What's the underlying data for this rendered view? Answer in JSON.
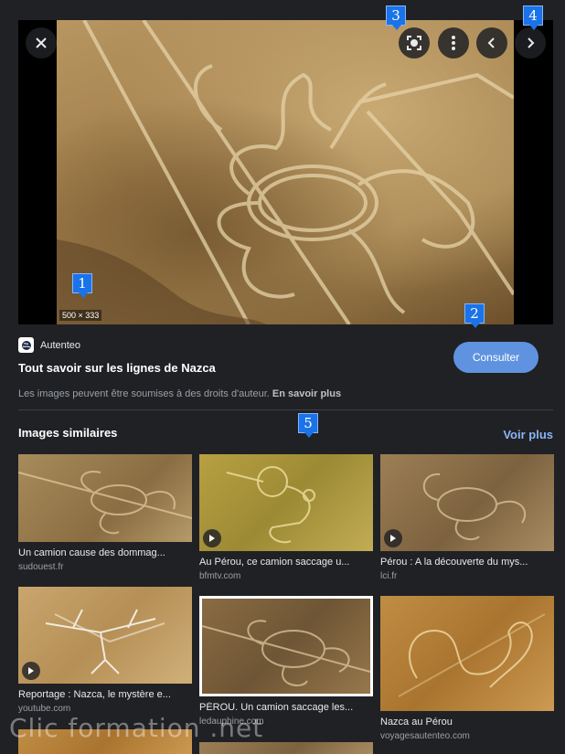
{
  "preview": {
    "dimensions": "500 × 333",
    "buttons": {
      "close_icon": "close-icon",
      "lens_icon": "lens-icon",
      "more_icon": "more-vert-icon",
      "prev_icon": "chevron-left-icon",
      "next_icon": "chevron-right-icon"
    }
  },
  "markers": [
    "1",
    "2",
    "3",
    "4",
    "5"
  ],
  "info": {
    "source_name": "Autenteo",
    "title": "Tout savoir sur les lignes de Nazca",
    "consult_label": "Consulter",
    "rights_text": "Les images peuvent être soumises à des droits d'auteur.",
    "rights_link": "En savoir plus"
  },
  "similar": {
    "heading": "Images similaires",
    "see_more": "Voir plus",
    "items": [
      {
        "title": "Un camion cause des dommag...",
        "source": "sudouest.fr",
        "video": false
      },
      {
        "title": "Au Pérou, ce camion saccage u...",
        "source": "bfmtv.com",
        "video": true
      },
      {
        "title": "Pérou : A la découverte du mys...",
        "source": "lci.fr",
        "video": true
      },
      {
        "title": "Reportage : Nazca, le mystère e...",
        "source": "youtube.com",
        "video": true
      },
      {
        "title": "PÉROU. Un camion saccage les...",
        "source": "ledauphine.com",
        "video": false
      },
      {
        "title": "Nazca au Pérou",
        "source": "voyagesautenteo.com",
        "video": false
      }
    ]
  },
  "watermark": "Clic formation .net",
  "colors": {
    "accent": "#8ab4f8",
    "button": "#5f93e0",
    "marker": "#1a73e8",
    "background": "#202124"
  }
}
